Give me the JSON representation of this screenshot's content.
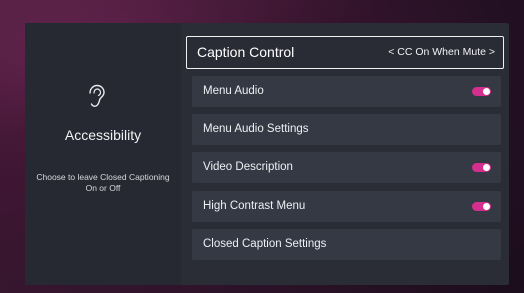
{
  "category": {
    "title": "Accessibility",
    "description": "Choose to leave Closed Captioning On or Off",
    "icon": "ear-icon"
  },
  "menu": {
    "caption_control": {
      "label": "Caption Control",
      "value": "< CC On When Mute >"
    },
    "menu_audio": {
      "label": "Menu Audio",
      "toggle": true
    },
    "menu_audio_settings": {
      "label": "Menu Audio Settings"
    },
    "video_description": {
      "label": "Video Description",
      "toggle": true
    },
    "high_contrast_menu": {
      "label": "High Contrast Menu",
      "toggle": true
    },
    "closed_caption_settings": {
      "label": "Closed Caption Settings"
    }
  },
  "colors": {
    "accent": "#d52f8d",
    "panel": "#2a2d36",
    "row": "#353944"
  }
}
